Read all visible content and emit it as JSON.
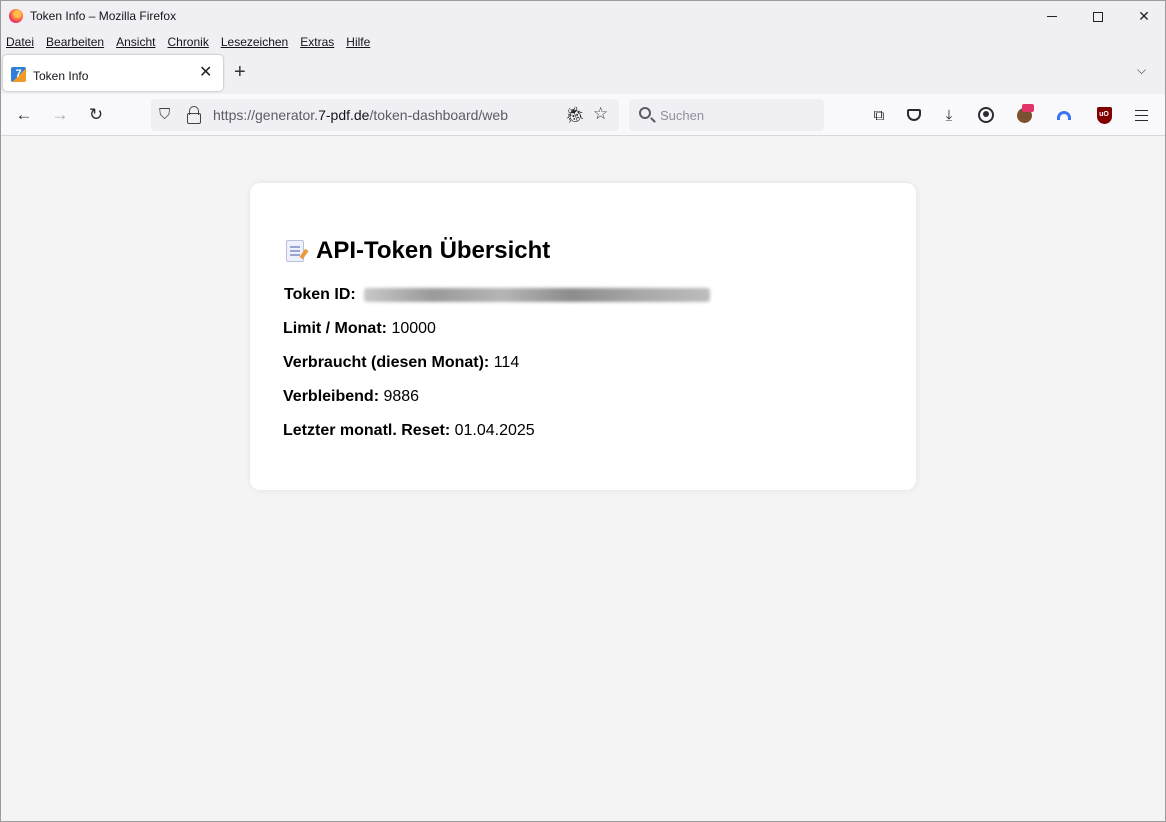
{
  "window": {
    "title": "Token Info – Mozilla Firefox"
  },
  "menu": {
    "items": [
      "Datei",
      "Bearbeiten",
      "Ansicht",
      "Chronik",
      "Lesezeichen",
      "Extras",
      "Hilfe"
    ]
  },
  "tabs": [
    {
      "title": "Token Info",
      "active": true
    }
  ],
  "navbar": {
    "url_prefix": "https://generator.",
    "url_domain": "7-pdf.de",
    "url_path": "/token-dashboard/web",
    "search_placeholder": "Suchen"
  },
  "card": {
    "title": "API-Token Übersicht",
    "rows": [
      {
        "label": "Token ID:",
        "value": ""
      },
      {
        "label": "Limit / Monat:",
        "value": "10000"
      },
      {
        "label": "Verbraucht (diesen Monat):",
        "value": "114"
      },
      {
        "label": "Verbleibend:",
        "value": "9886"
      },
      {
        "label": "Letzter monatl. Reset:",
        "value": "01.04.2025"
      }
    ]
  },
  "icons": {
    "titlebar": [
      "firefox-logo-icon",
      "minimize-icon",
      "maximize-icon",
      "close-icon"
    ],
    "navbar": [
      "back-arrow-icon",
      "forward-arrow-icon",
      "reload-icon",
      "shield-icon",
      "lock-icon",
      "bug-icon",
      "star-icon",
      "search-icon",
      "extensions-icon",
      "pocket-icon",
      "download-icon",
      "account-icon",
      "addon-icon",
      "vpn-icon",
      "ublock-icon",
      "hamburger-menu-icon"
    ]
  },
  "colors": {
    "page_background": "#f4f4f4",
    "card_background": "#ffffff",
    "chrome_background": "#f0f0f4"
  }
}
